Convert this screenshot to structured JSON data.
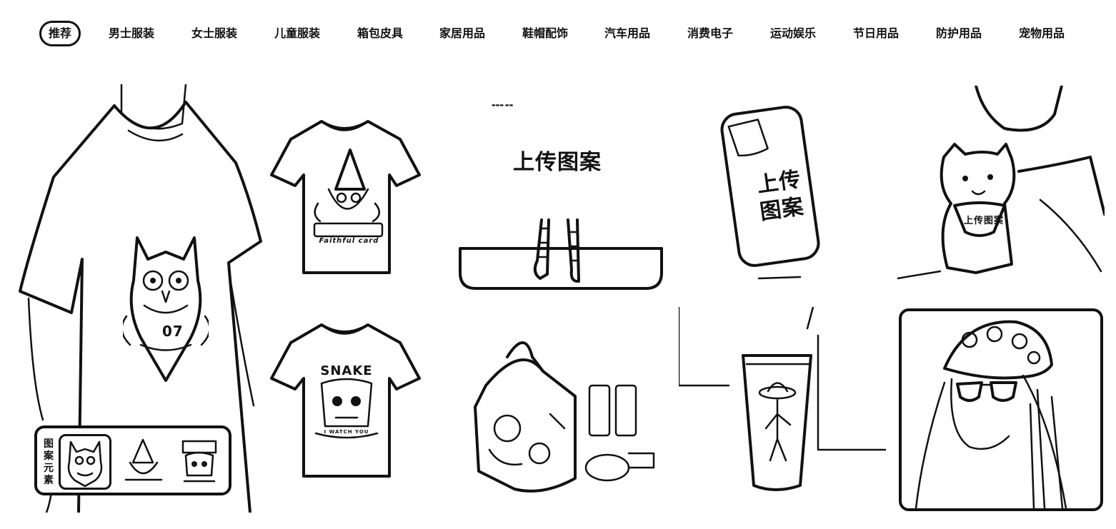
{
  "nav": {
    "items": [
      {
        "label": "推荐",
        "active": true
      },
      {
        "label": "男士服装"
      },
      {
        "label": "女士服装"
      },
      {
        "label": "儿童服装"
      },
      {
        "label": "箱包皮具"
      },
      {
        "label": "家居用品"
      },
      {
        "label": "鞋帽配饰"
      },
      {
        "label": "汽车用品"
      },
      {
        "label": "消费电子"
      },
      {
        "label": "运动娱乐"
      },
      {
        "label": "节日用品"
      },
      {
        "label": "防护用品"
      },
      {
        "label": "宠物用品"
      }
    ]
  },
  "hero": {
    "shirt_print_number": "07",
    "picker_label": "图\n案\n元\n素",
    "picker_selected_index": 0
  },
  "tshirts": {
    "gnome_text": "Faithful card",
    "skull_title": "SNAKE",
    "skull_subtitle": "I WATCH YOU"
  },
  "upload": {
    "label": "上传图案",
    "phone_label_line1": "上传",
    "phone_label_line2": "图案",
    "pet_label": "上传图案"
  },
  "icons": {
    "owl": "owl-print-icon",
    "gnome": "gnome-print-icon",
    "skull": "skull-print-icon"
  }
}
